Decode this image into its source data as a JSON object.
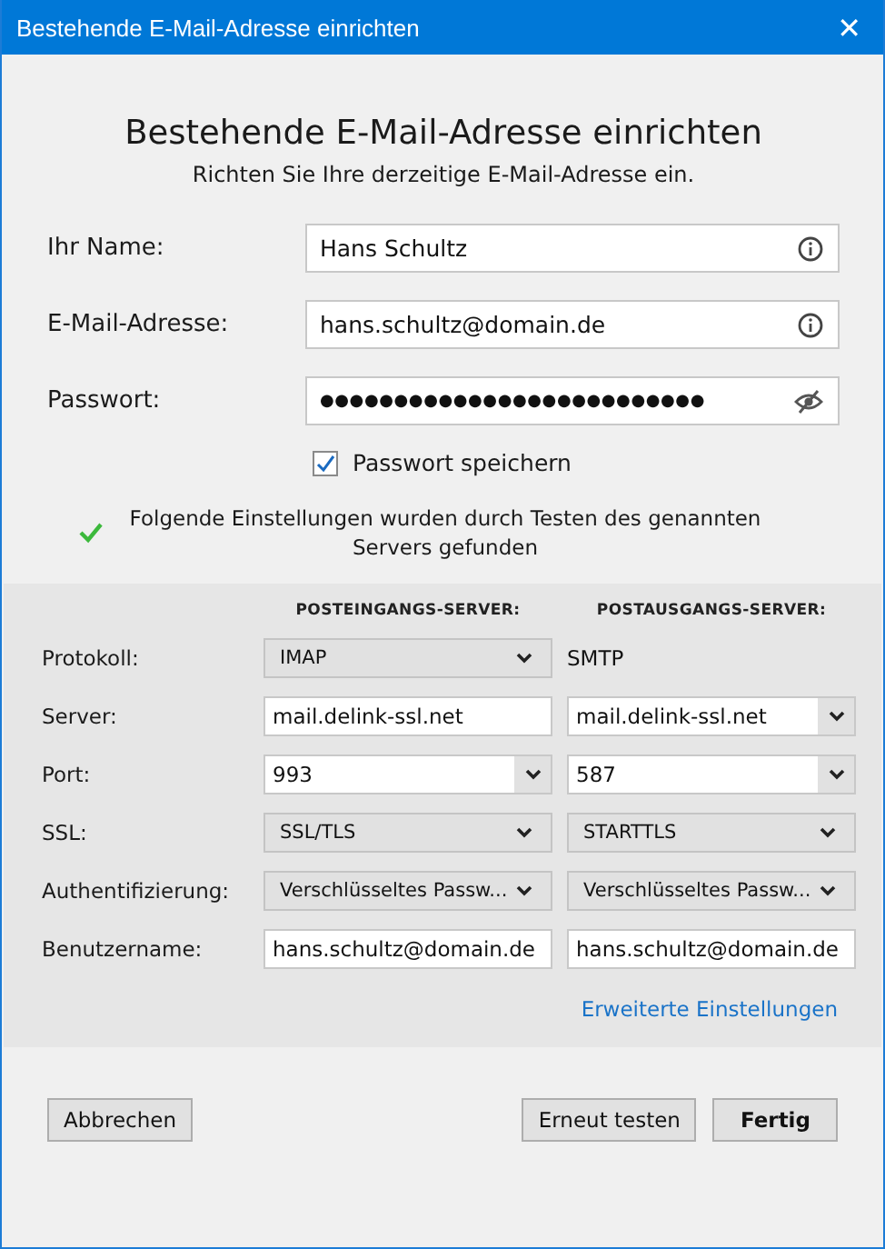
{
  "window": {
    "title": "Bestehende E-Mail-Adresse einrichten",
    "close": "✕"
  },
  "heading": "Bestehende E-Mail-Adresse einrichten",
  "subtitle": "Richten Sie Ihre derzeitige E-Mail-Adresse ein.",
  "fields": [
    {
      "label": "Ihr Name:",
      "value": "Hans Schultz",
      "kind": "info"
    },
    {
      "label": "E-Mail-Adresse:",
      "value": "hans.schultz@domain.de",
      "kind": "info"
    },
    {
      "label": "Passwort:",
      "value": "●●●●●●●●●●●●●●●●●●●●●●●●●●",
      "kind": "password"
    }
  ],
  "remember_password": {
    "label": "Passwort speichern",
    "checked": true
  },
  "status": {
    "text": "Folgende Einstellungen wurden durch Testen des genannten Servers gefunden",
    "success": true
  },
  "server_settings": {
    "columns": [
      "POSTEINGANGS-SERVER:",
      "POSTAUSGANGS-SERVER:"
    ],
    "rows": [
      {
        "label": "Protokoll:",
        "cells": [
          {
            "kind": "select",
            "value": "IMAP"
          },
          {
            "kind": "text",
            "value": "SMTP"
          }
        ]
      },
      {
        "label": "Server:",
        "cells": [
          {
            "kind": "input",
            "value": "mail.delink-ssl.net"
          },
          {
            "kind": "combo",
            "value": "mail.delink-ssl.net"
          }
        ]
      },
      {
        "label": "Port:",
        "cells": [
          {
            "kind": "combo",
            "value": "993"
          },
          {
            "kind": "combo",
            "value": "587"
          }
        ]
      },
      {
        "label": "SSL:",
        "cells": [
          {
            "kind": "select",
            "value": "SSL/TLS"
          },
          {
            "kind": "select",
            "value": "STARTTLS"
          }
        ]
      },
      {
        "label": "Authentifizierung:",
        "cells": [
          {
            "kind": "select",
            "value": "Verschlüsseltes Passw..."
          },
          {
            "kind": "select",
            "value": "Verschlüsseltes Passw..."
          }
        ]
      },
      {
        "label": "Benutzername:",
        "cells": [
          {
            "kind": "input",
            "value": "hans.schultz@domain.de"
          },
          {
            "kind": "input",
            "value": "hans.schultz@domain.de"
          }
        ]
      }
    ],
    "advanced_link": "Erweiterte Einstellungen"
  },
  "buttons": [
    {
      "label": "Abbrechen",
      "kind": "normal"
    },
    {
      "label": "Erneut testen",
      "kind": "normal"
    },
    {
      "label": "Fertig",
      "kind": "default"
    }
  ]
}
